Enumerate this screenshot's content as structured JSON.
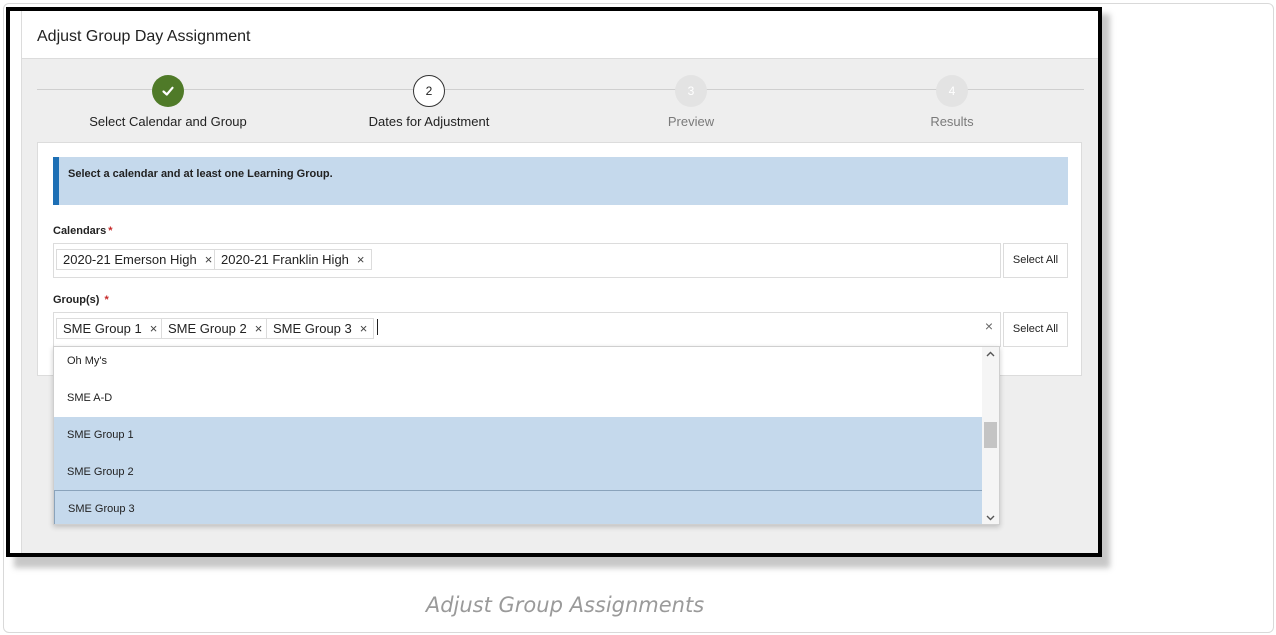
{
  "title": "Adjust Group Day Assignment",
  "steps": [
    {
      "number": "",
      "label": "Select Calendar and Group",
      "state": "done"
    },
    {
      "number": "2",
      "label": "Dates for Adjustment",
      "state": "current"
    },
    {
      "number": "3",
      "label": "Preview",
      "state": "future"
    },
    {
      "number": "4",
      "label": "Results",
      "state": "future"
    }
  ],
  "info_message": "Select a calendar and at least one Learning Group.",
  "calendars": {
    "label": "Calendars",
    "required_mark": "*",
    "chips": [
      "2020-21 Emerson High",
      "2020-21 Franklin High"
    ],
    "select_all": "Select All"
  },
  "groups": {
    "label": "Group(s)",
    "required_mark": "*",
    "chips": [
      "SME Group 1",
      "SME Group 2",
      "SME Group 3"
    ],
    "select_all": "Select All",
    "options": [
      {
        "label": "Oh My's",
        "selected": false
      },
      {
        "label": "SME A-D",
        "selected": false
      },
      {
        "label": "SME Group 1",
        "selected": true
      },
      {
        "label": "SME Group 2",
        "selected": true
      },
      {
        "label": "SME Group 3",
        "selected": true
      }
    ]
  },
  "icons": {
    "remove": "×",
    "clear": "×",
    "check": "✓",
    "scroll_up": "^",
    "scroll_down": "v"
  },
  "colors": {
    "accent_blue": "#1d6fb5",
    "banner_bg": "#c5d9ec",
    "done_green": "#4f7a28",
    "required_red": "#c62828"
  },
  "caption": "Adjust Group Assignments"
}
